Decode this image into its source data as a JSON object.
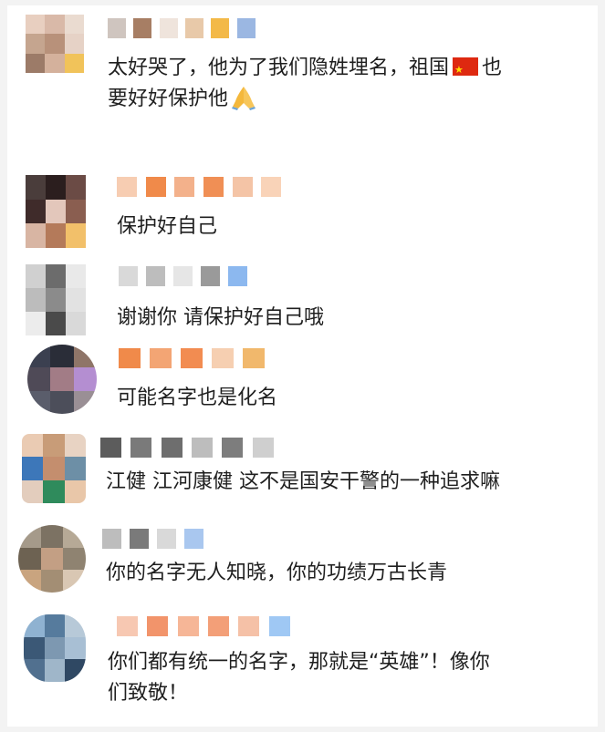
{
  "comments": [
    {
      "id": "c1",
      "avatar_colors": [
        "#e8cfc0",
        "#d9b9a8",
        "#eadbd0",
        "#c5a58f",
        "#b8917a",
        "#e6d2c6",
        "#9c7b68",
        "#d4b19c",
        "#f1c35a"
      ],
      "name_colors": [
        "#cfc5bf",
        "#a77e64",
        "#efe4dc",
        "#e8c9a9",
        "#f3b948",
        "#9bb7e2"
      ],
      "line1": "太好哭了，他为了我们隐姓埋名，祖国",
      "line1_after": "也",
      "line2": "要好好保护他",
      "flag_icon": "china-flag",
      "pray_icon": "folded-hands"
    },
    {
      "id": "c2",
      "avatar_colors": [
        "#4a3d3b",
        "#2b1e1e",
        "#6b4b45",
        "#3f2b2a",
        "#e3c7bb",
        "#8a5e50",
        "#d8b5a3",
        "#b47a5a",
        "#f2c06a"
      ],
      "name_colors": [
        "#f7cdb2",
        "#f08a4a",
        "#f3b18b",
        "#f08f55",
        "#f4c4a6",
        "#f9d3b8"
      ],
      "text": "保护好自己"
    },
    {
      "id": "c3",
      "avatar_colors": [
        "#d0d0d0",
        "#6c6c6c",
        "#e9e9e9",
        "#bcbcbc",
        "#8b8b8b",
        "#e2e2e2",
        "#ececec",
        "#4a4a4a",
        "#d9d9d9"
      ],
      "name_colors": [
        "#d9d9d9",
        "#bdbdbd",
        "#e6e6e6",
        "#9a9a9a",
        "#8cb8ef"
      ],
      "text": "谢谢你 请保护好自己哦"
    },
    {
      "id": "c4",
      "avatar_colors": [
        "#3b4050",
        "#2a2d38",
        "#8f7568",
        "#4f4a57",
        "#a27c86",
        "#b48ed1",
        "#5a5d6b",
        "#4c4e5a",
        "#9a8f95"
      ],
      "name_colors": [
        "#f08a4a",
        "#f3a574",
        "#f28c51",
        "#f6cfb1",
        "#f1b86c"
      ],
      "text": "可能名字也是化名"
    },
    {
      "id": "c5",
      "avatar_colors": [
        "#eacbb3",
        "#c89c78",
        "#e8d3c3",
        "#3d77b9",
        "#c48e6e",
        "#6d8fa6",
        "#e3cdbd",
        "#2f8b5c",
        "#e9c7a9"
      ],
      "name_colors": [
        "#5c5c5c",
        "#7a7a7a",
        "#6e6e6e",
        "#bdbdbd",
        "#7d7d7d",
        "#cfcfcf"
      ],
      "text": "江健 江河康健 这不是国安干警的一种追求嘛"
    },
    {
      "id": "c6",
      "avatar_colors": [
        "#a59a8a",
        "#7c7263",
        "#b6a996",
        "#6d6252",
        "#c39f84",
        "#8f8371",
        "#c9a47f",
        "#a38e74",
        "#d9c7b3"
      ],
      "name_colors": [
        "#bdbdbd",
        "#7a7a7a",
        "#d9d9d9",
        "#a9c7ef"
      ],
      "text": "你的名字无人知晓，你的功绩万古长青"
    },
    {
      "id": "c7",
      "avatar_colors": [
        "#8fb2d1",
        "#567b9d",
        "#b7c9d8",
        "#3b5876",
        "#7d98b1",
        "#a8bfd4",
        "#51708f",
        "#9fb6c9",
        "#2f4863"
      ],
      "name_colors": [
        "#f7c8b2",
        "#f2946b",
        "#f6b697",
        "#f39f78",
        "#f5c1a7",
        "#9fc8f4"
      ],
      "line1": "你们都有统一的名字，那就是“英雄”！像你",
      "line2": "们致敬！"
    }
  ]
}
